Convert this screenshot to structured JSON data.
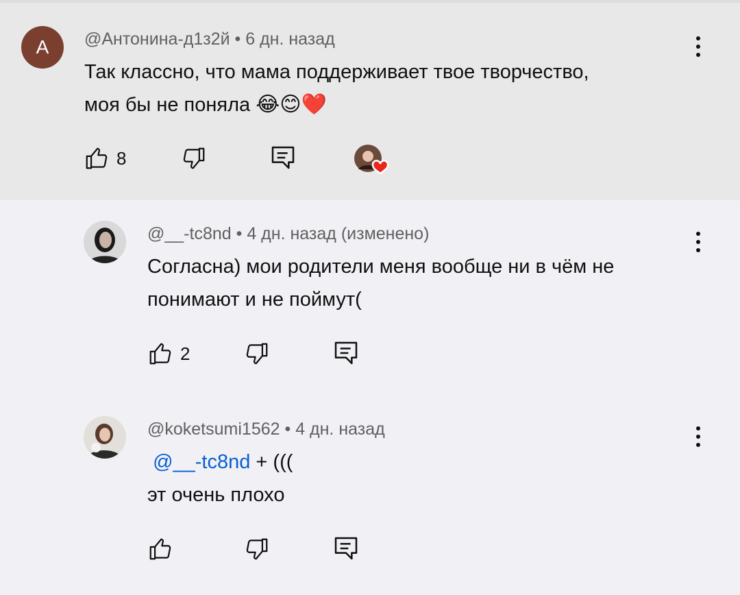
{
  "comments": [
    {
      "author": "@Антонина-д1з2й",
      "avatar_letter": "А",
      "time": "6 дн. назад",
      "edited": "",
      "lines": [
        "Так классно, что мама поддерживает твое творчество,",
        "моя бы не поняла"
      ],
      "emojis": "😂😊❤️",
      "likes": "8",
      "highlighted": true,
      "creator_heart": true
    },
    {
      "author": "@__-tc8nd",
      "time": "4 дн. назад",
      "edited": "(изменено)",
      "lines": [
        "Согласна) мои родители меня вообще ни в чём не",
        "понимают и не поймут("
      ],
      "likes": "2"
    },
    {
      "author": "@koketsumi1562",
      "time": "4 дн. назад",
      "mention": "@__-tc8nd",
      "mention_suffix": " + (((",
      "lines": [
        "эт очень плохо"
      ],
      "likes": ""
    }
  ],
  "separator": " • ",
  "icons": {
    "like": "thumb-up-icon",
    "dislike": "thumb-down-icon",
    "reply": "reply-icon",
    "more": "more-vert-icon"
  },
  "colors": {
    "highlight": "#e8e8e8",
    "background": "#f1f1f5",
    "mention": "#065fd4",
    "avatar_a": "#7b3f2f"
  }
}
